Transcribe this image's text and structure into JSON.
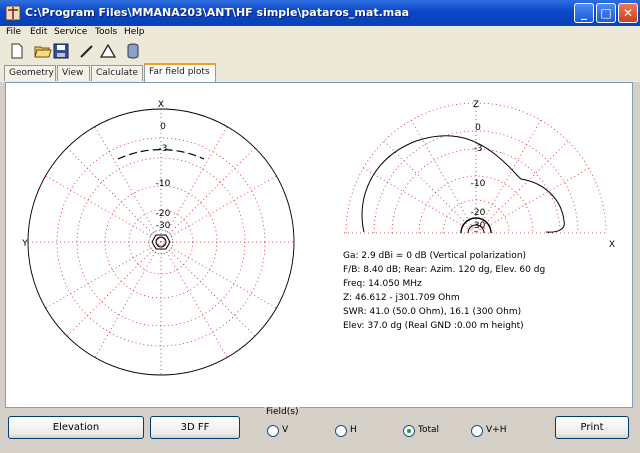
{
  "window": {
    "title": "C:\\Program Files\\MMANA203\\ANT\\HF simple\\pataros_mat.maa",
    "minimize_label": "_",
    "maximize_label": "□",
    "close_label": "✕"
  },
  "menu": {
    "items": [
      "File",
      "Edit",
      "Service",
      "Tools",
      "Help"
    ]
  },
  "toolbar": {
    "icons": [
      "new-file-icon",
      "open-folder-icon",
      "save-disk-icon",
      "pencil-icon",
      "triangle-icon",
      "database-icon"
    ]
  },
  "tabs": {
    "items": [
      "Geometry",
      "View",
      "Calculate",
      "Far field plots"
    ],
    "active": "Far field plots"
  },
  "plot": {
    "left": {
      "axis_top": "X",
      "axis_left": "Y",
      "ring_labels": [
        "0",
        "-3",
        "-10",
        "-20",
        "-30"
      ]
    },
    "right": {
      "axis_top": "Z",
      "axis_right": "X",
      "ring_labels": [
        "0",
        "-3",
        "-10",
        "-20",
        "-30"
      ]
    },
    "info": [
      "Ga: 2.9 dBi = 0 dB (Vertical polarization)",
      "F/B: 8.40 dB; Rear: Azim. 120 dg, Elev. 60 dg",
      "Freq: 14.050 MHz",
      "Z: 46.612 - j301.709 Ohm",
      "SWR: 41.0 (50.0 Ohm), 16.1 (300 Ohm)",
      "Elev: 37.0 dg (Real GND :0.00 m height)"
    ],
    "colors": {
      "grid": "#d02020",
      "pattern": "#000000"
    }
  },
  "bottom": {
    "elevation_button": "Elevation",
    "d3_button": "3D FF",
    "print_button": "Print",
    "field_group": {
      "legend": "Field(s)",
      "options": [
        "V",
        "H",
        "Total",
        "V+H"
      ],
      "selected": "Total"
    }
  }
}
